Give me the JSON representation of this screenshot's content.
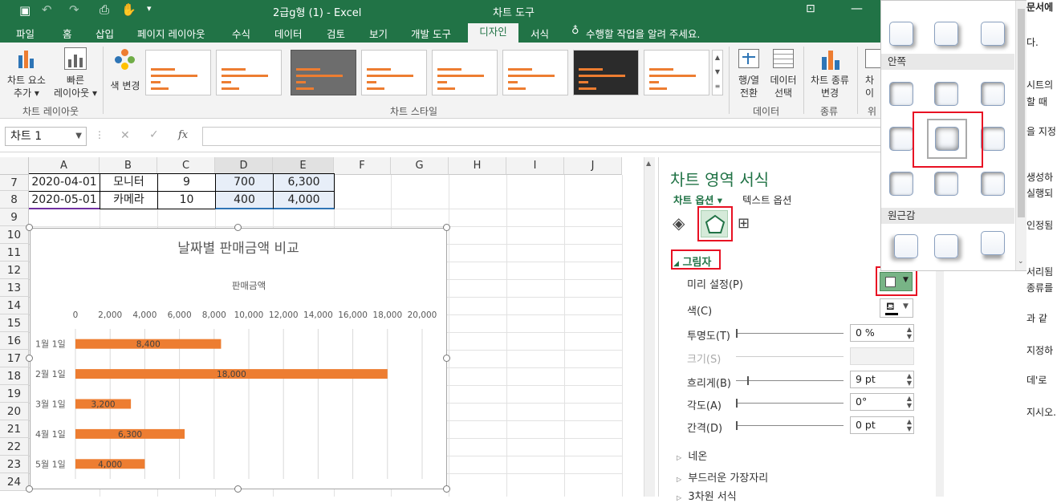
{
  "titlebar": {
    "title": "2급g형 (1)  -  Excel",
    "tools": "차트 도구"
  },
  "tabs": [
    "파일",
    "홈",
    "삽입",
    "페이지 레이아웃",
    "수식",
    "데이터",
    "검토",
    "보기",
    "개발 도구",
    "디자인",
    "서식"
  ],
  "tell_me": "수행할 작업을 알려 주세요.",
  "ribbon": {
    "add_element": [
      "차트 요소",
      "추가 ▾"
    ],
    "quick_layout": [
      "빠른",
      "레이아웃 ▾"
    ],
    "change_colors": "색 변경",
    "group_layouts": "차트 레이아웃",
    "group_styles": "차트 스타일",
    "switch_rowcol": [
      "행/열",
      "전환"
    ],
    "select_data": [
      "데이터",
      "선택"
    ],
    "group_data": "데이터",
    "change_type": [
      "차트 종류",
      "변경"
    ],
    "group_type": "종류",
    "move_chart": [
      "차",
      "이"
    ],
    "group_loc": "위"
  },
  "formulabar": {
    "namebox": "차트 1",
    "fx": "fx"
  },
  "columns": [
    "A",
    "B",
    "C",
    "D",
    "E",
    "F",
    "G",
    "H",
    "I",
    "J"
  ],
  "rows": [
    "7",
    "8",
    "9",
    "10",
    "11",
    "12",
    "13",
    "14",
    "15",
    "16",
    "17",
    "18",
    "19",
    "20",
    "21",
    "22",
    "23",
    "24"
  ],
  "cells": {
    "r7": [
      "2020-04-01",
      "모니터",
      "9",
      "700",
      "6,300"
    ],
    "r8": [
      "2020-05-01",
      "카메라",
      "10",
      "400",
      "4,000"
    ]
  },
  "chart_data": {
    "type": "bar",
    "title": "날짜별 판매금액 비교",
    "axis_title": "판매금액",
    "categories": [
      "1월 1일",
      "2월 1일",
      "3월 1일",
      "4월 1일",
      "5월 1일"
    ],
    "values": [
      8400,
      18000,
      3200,
      6300,
      4000
    ],
    "value_labels": [
      "8,400",
      "18,000",
      "3,200",
      "6,300",
      "4,000"
    ],
    "ticks": [
      "0",
      "2,000",
      "4,000",
      "6,000",
      "8,000",
      "10,000",
      "12,000",
      "14,000",
      "16,000",
      "18,000",
      "20,000"
    ],
    "xlim": [
      0,
      20000
    ],
    "color": "#ed7d31",
    "grid": true
  },
  "pane": {
    "title": "차트 영역 서식",
    "tab_chart": "차트 옵션 ▾",
    "tab_text": "텍스트 옵션",
    "section_shadow": "그림자",
    "preset": "미리 설정(P)",
    "color": "색(C)",
    "transparency": "투명도(T)",
    "transparency_val": "0 %",
    "size": "크기(S)",
    "blur": "흐리게(B)",
    "blur_val": "9 pt",
    "angle": "각도(A)",
    "angle_val": "0°",
    "distance": "간격(D)",
    "distance_val": "0 pt",
    "glow": "네온",
    "soft_edges": "부드러운 가장자리",
    "three_d": "3차원 서식"
  },
  "gallery": {
    "inner": "안쪽",
    "perspective": "원근감"
  },
  "doc_right": [
    "문서에",
    "다.",
    "시트의",
    "할 때",
    "을 지정",
    "생성하",
    "실행되",
    "인정됨",
    "서리됨",
    "종류를",
    "과 같",
    "지정하",
    "데'로",
    "지시오."
  ]
}
